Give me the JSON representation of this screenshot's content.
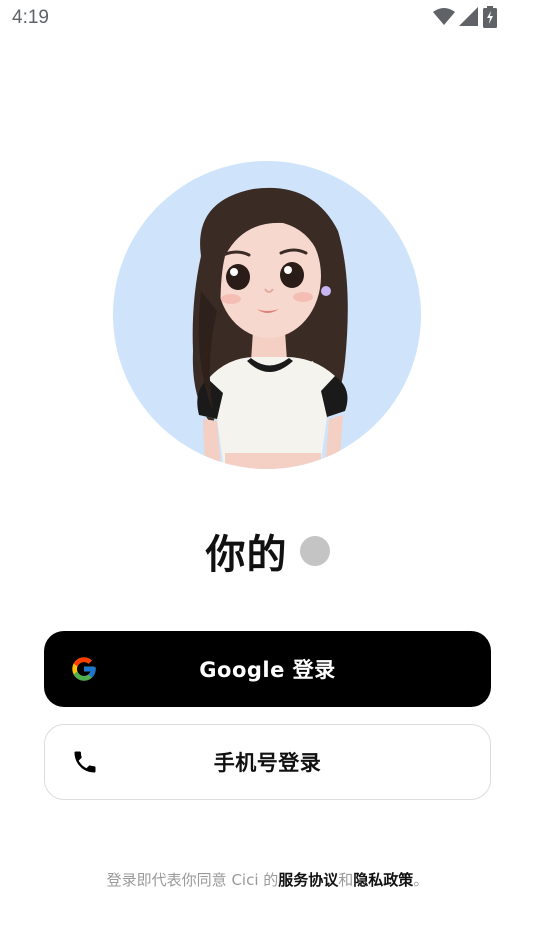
{
  "status_bar": {
    "time": "4:19",
    "icons": [
      "wifi-icon",
      "cellular-signal-icon",
      "battery-charging-icon"
    ]
  },
  "avatar": {
    "icon": "avatar-character-illustration",
    "background_color": "#cfe4fb"
  },
  "title": {
    "text": "你的"
  },
  "buttons": {
    "google": {
      "label": "Google 登录",
      "icon": "google-logo-icon",
      "background": "#000000",
      "text_color": "#ffffff"
    },
    "phone": {
      "label": "手机号登录",
      "icon": "phone-icon",
      "background": "#ffffff",
      "text_color": "#111111"
    }
  },
  "footer": {
    "prefix": "登录即代表你同意 Cici 的",
    "terms_link": "服务协议",
    "conjunction": "和",
    "privacy_link": "隐私政策",
    "suffix": "。"
  },
  "colors": {
    "muted_text": "#9a9a9a",
    "border": "#dcdcdc",
    "loading_dot": "#c4c4c4"
  }
}
